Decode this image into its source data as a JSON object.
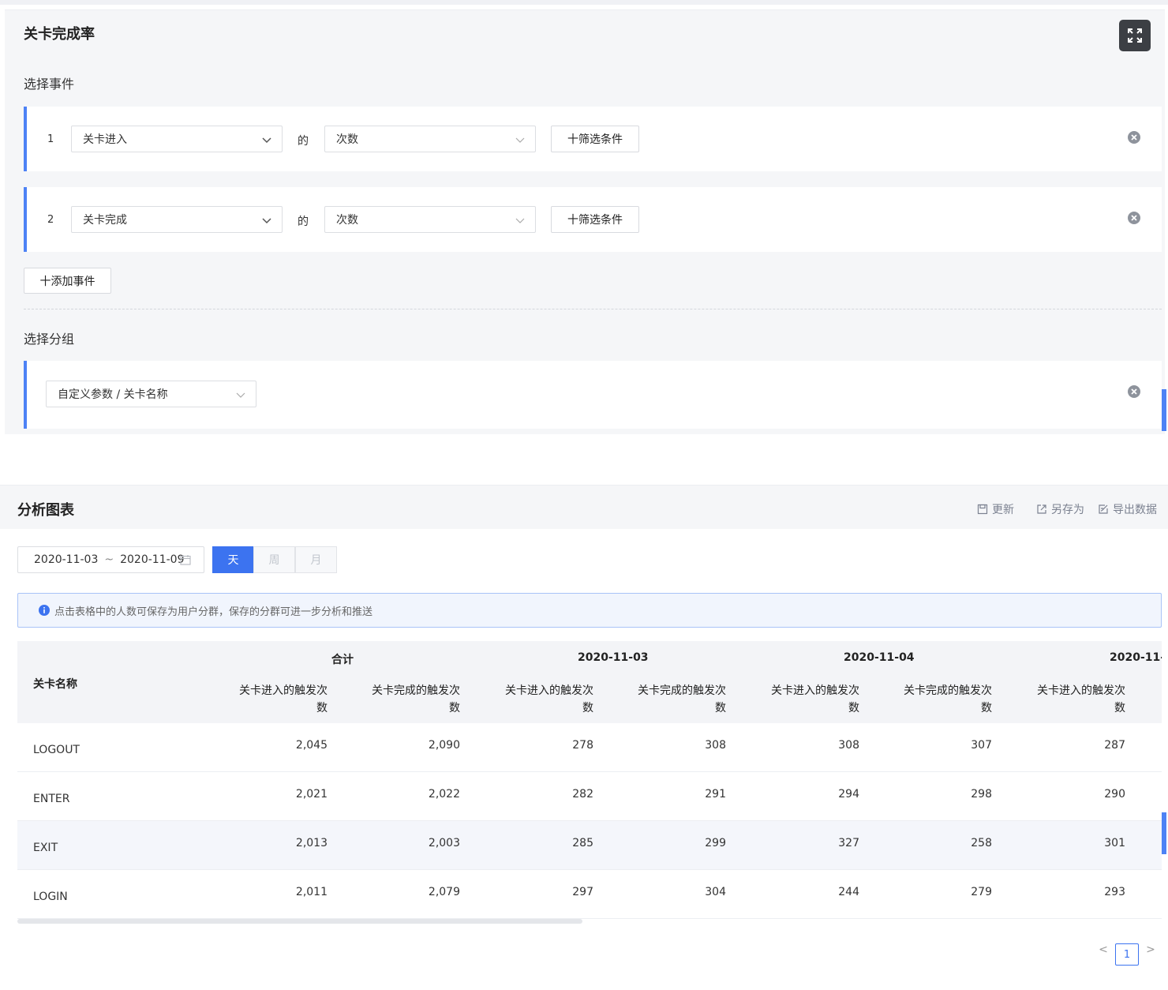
{
  "config": {
    "title": "关卡完成率",
    "select_event_label": "选择事件",
    "events": [
      {
        "index": "1",
        "event": "关卡进入",
        "of": "的",
        "metric": "次数",
        "filter_label": "十筛选条件"
      },
      {
        "index": "2",
        "event": "关卡完成",
        "of": "的",
        "metric": "次数",
        "filter_label": "十筛选条件"
      }
    ],
    "add_event_label": "十添加事件",
    "select_group_label": "选择分组",
    "group_value": "自定义参数 / 关卡名称"
  },
  "analysis": {
    "title": "分析图表",
    "actions": {
      "refresh": "更新",
      "save_as": "另存为",
      "export": "导出数据"
    },
    "date_start": "2020-11-03",
    "date_sep": "~",
    "date_end": "2020-11-09",
    "granularity": [
      "天",
      "周",
      "月"
    ],
    "granularity_selected": "天",
    "info_text": "点击表格中的人数可保存为用户分群，保存的分群可进一步分析和推送"
  },
  "table": {
    "name_header": "关卡名称",
    "groups": [
      "合计",
      "2020-11-03",
      "2020-11-04",
      "2020-11-("
    ],
    "sub_headers": [
      [
        "关卡进入的触发次",
        "数"
      ],
      [
        "关卡完成的触发次",
        "数"
      ],
      [
        "关卡进入的触发次",
        "数"
      ],
      [
        "关卡完成的触发次",
        "数"
      ],
      [
        "关卡进入的触发次",
        "数"
      ],
      [
        "关卡完成的触发次",
        "数"
      ],
      [
        "关卡进入的触发次",
        "数"
      ]
    ],
    "rows": [
      {
        "name": "LOGOUT",
        "values": [
          "2,045",
          "2,090",
          "278",
          "308",
          "308",
          "307",
          "287"
        ]
      },
      {
        "name": "ENTER",
        "values": [
          "2,021",
          "2,022",
          "282",
          "291",
          "294",
          "298",
          "290"
        ]
      },
      {
        "name": "EXIT",
        "values": [
          "2,013",
          "2,003",
          "285",
          "299",
          "327",
          "258",
          "301"
        ]
      },
      {
        "name": "LOGIN",
        "values": [
          "2,011",
          "2,079",
          "297",
          "304",
          "244",
          "279",
          "293"
        ]
      }
    ]
  },
  "pagination": {
    "current": "1",
    "prev": "<",
    "next": ">"
  },
  "colors": {
    "accent": "#3c73f0",
    "card_border": "#4d82f5",
    "info_border": "#a9c3f7"
  }
}
